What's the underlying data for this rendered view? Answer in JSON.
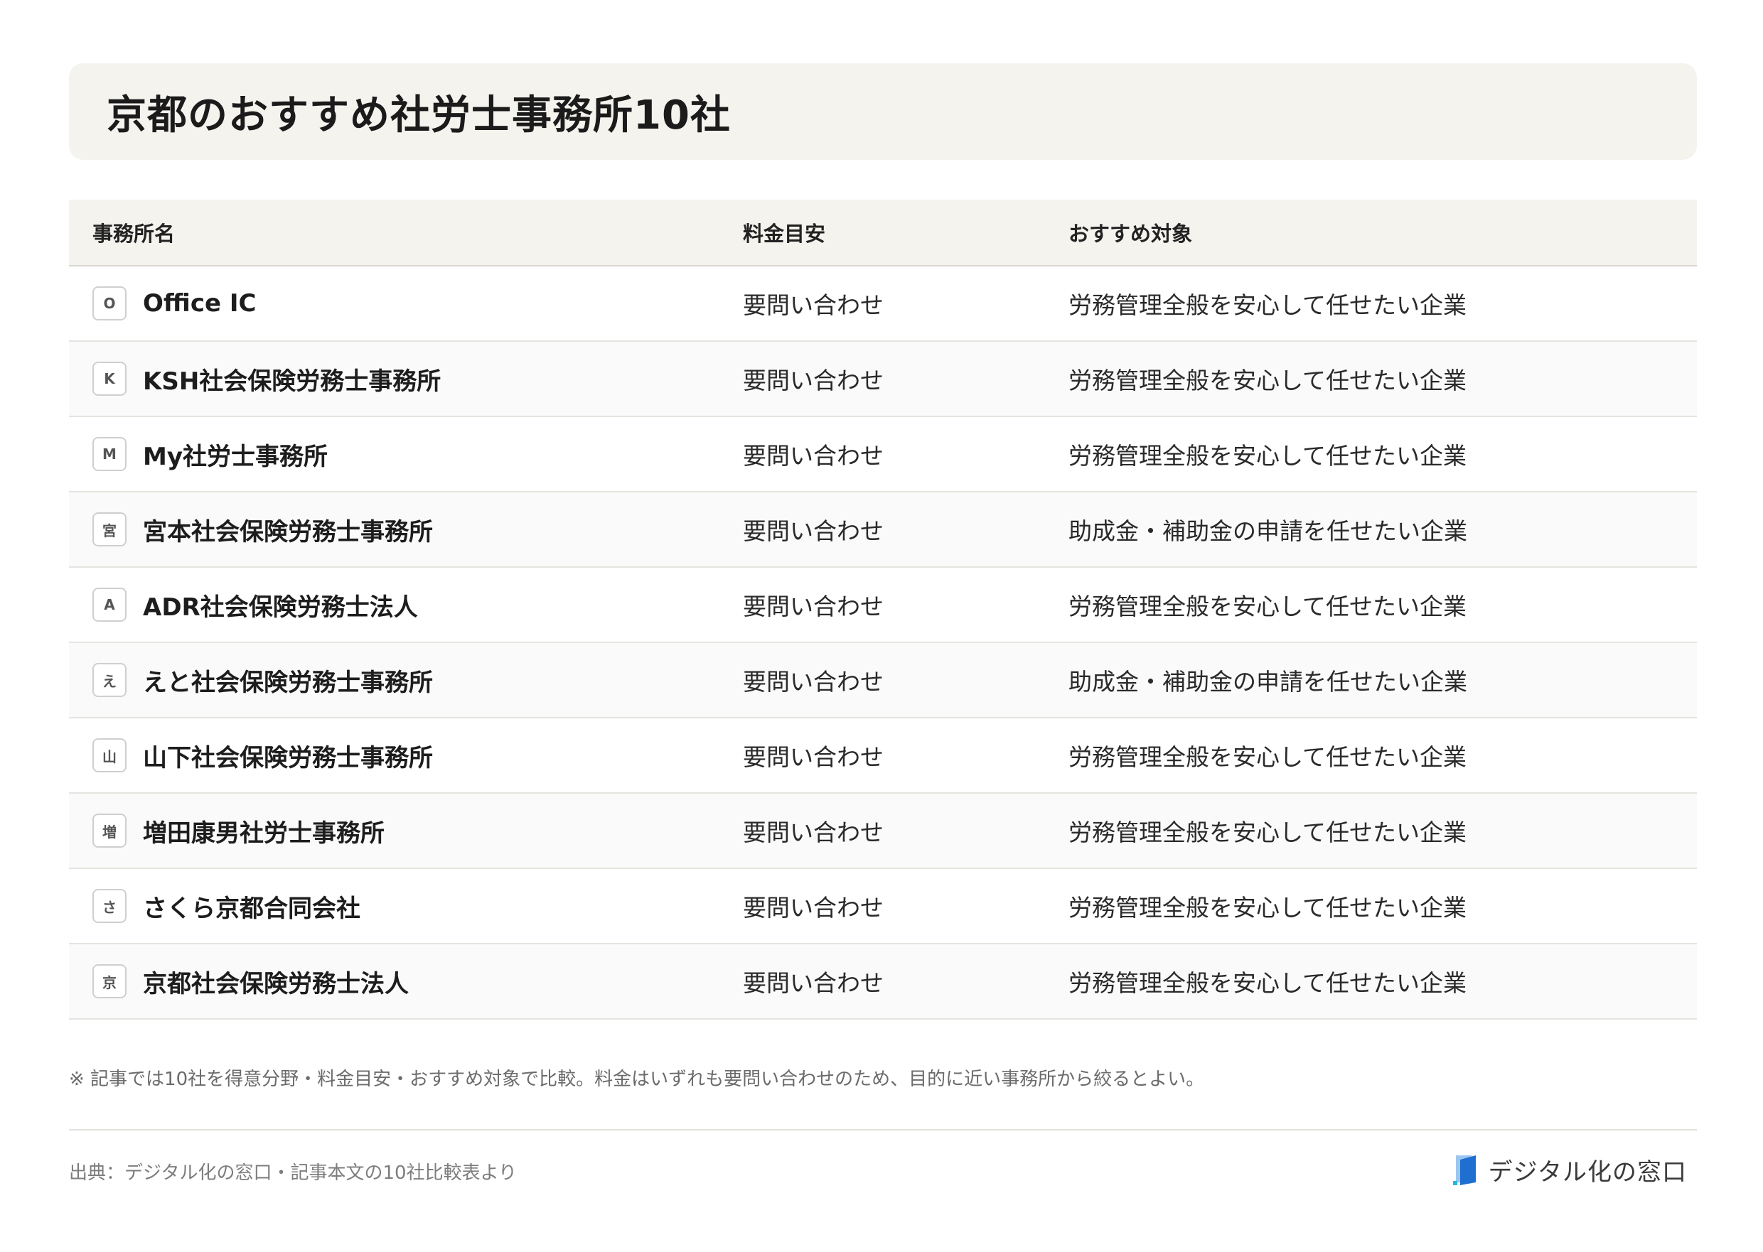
{
  "title": "京都のおすすめ社労士事務所10社",
  "table": {
    "headers": [
      "事務所名",
      "料金目安",
      "おすすめ対象"
    ],
    "rows": [
      {
        "badge": "O",
        "name": "Office IC",
        "price": "要問い合わせ",
        "target": "労務管理全般を安心して任せたい企業"
      },
      {
        "badge": "K",
        "name": "KSH社会保険労務士事務所",
        "price": "要問い合わせ",
        "target": "労務管理全般を安心して任せたい企業"
      },
      {
        "badge": "M",
        "name": "My社労士事務所",
        "price": "要問い合わせ",
        "target": "労務管理全般を安心して任せたい企業"
      },
      {
        "badge": "宮",
        "name": "宮本社会保険労務士事務所",
        "price": "要問い合わせ",
        "target": "助成金・補助金の申請を任せたい企業"
      },
      {
        "badge": "A",
        "name": "ADR社会保険労務士法人",
        "price": "要問い合わせ",
        "target": "労務管理全般を安心して任せたい企業"
      },
      {
        "badge": "え",
        "name": "えと社会保険労務士事務所",
        "price": "要問い合わせ",
        "target": "助成金・補助金の申請を任せたい企業"
      },
      {
        "badge": "山",
        "name": "山下社会保険労務士事務所",
        "price": "要問い合わせ",
        "target": "労務管理全般を安心して任せたい企業"
      },
      {
        "badge": "増",
        "name": "増田康男社労士事務所",
        "price": "要問い合わせ",
        "target": "労務管理全般を安心して任せたい企業"
      },
      {
        "badge": "さ",
        "name": "さくら京都合同会社",
        "price": "要問い合わせ",
        "target": "労務管理全般を安心して任せたい企業"
      },
      {
        "badge": "京",
        "name": "京都社会保険労務士法人",
        "price": "要問い合わせ",
        "target": "労務管理全般を安心して任せたい企業"
      }
    ]
  },
  "note": "※ 記事では10社を得意分野・料金目安・おすすめ対象で比較。料金はいずれも要問い合わせのため、目的に近い事務所から絞るとよい。",
  "source": "出典：デジタル化の窓口・記事本文の10社比較表より",
  "logo": {
    "text": "デジタル化の窓口",
    "icon": "document-logo-icon"
  },
  "colors": {
    "header_bg": "#f5f3ee",
    "logo_blue": "#1f6fd1",
    "logo_cyan": "#22b8e0"
  }
}
